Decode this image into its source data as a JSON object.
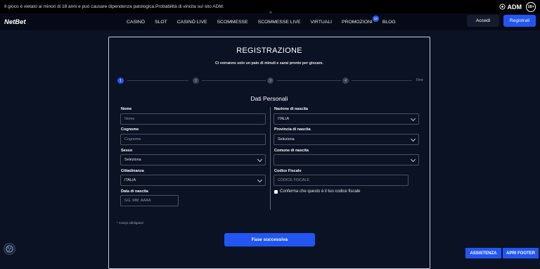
{
  "topbar": {
    "notice": "Il gioco è vietato ai minori di 18 anni e può causare dipendenza patologica.Probabilità di vincita sul sito ADM.",
    "adm": "ADM",
    "age": "18+"
  },
  "header": {
    "brand": "NetBet",
    "nav": [
      "CASINÒ",
      "SLOT",
      "CASINÒ LIVE",
      "SCOMMESSE",
      "SCOMMESSE LIVE",
      "VIRTUALI",
      "PROMOZIONI",
      "BLOG"
    ],
    "promo_badge": "13",
    "login_label": "Accedi",
    "register_label": "Registrati"
  },
  "form": {
    "title": "REGISTRAZIONE",
    "subtitle": "Ci vorranno solo un paio di minuti e sarai pronto per giocare.",
    "steps": [
      "1",
      "2",
      "3",
      "4"
    ],
    "steps_end": "Fine",
    "active_step": 1,
    "section_title": "Dati Personali",
    "nome": {
      "label": "Nome",
      "placeholder": "Nome"
    },
    "cognome": {
      "label": "Cognome",
      "placeholder": "Cognome"
    },
    "sesso": {
      "label": "Sesso",
      "value": "Seleziona"
    },
    "cittadinanza": {
      "label": "Cittadinanza",
      "value": "ITALIA"
    },
    "data_nascita": {
      "label": "Data di nascita",
      "placeholder": "GG. MM. AAAA"
    },
    "nazione": {
      "label": "Nazione di nascita",
      "value": "ITALIA"
    },
    "provincia": {
      "label": "Provincia di nascita",
      "value": "Seleziona"
    },
    "comune": {
      "label": "Comune di nascita",
      "value": ""
    },
    "codice_fiscale": {
      "label": "Codice Fiscale",
      "placeholder": "CODICE FISCALE"
    },
    "confirm_cf": "Conferma che questo è il tuo codice fiscale",
    "required_note": "* Campi obbligatori",
    "next_button": "Fase successiva"
  },
  "footer": {
    "assistance": "ASSISTENZA",
    "open_footer": "APRI FOOTER"
  },
  "colors": {
    "background": "#0b1224",
    "accent": "#2256f2"
  }
}
